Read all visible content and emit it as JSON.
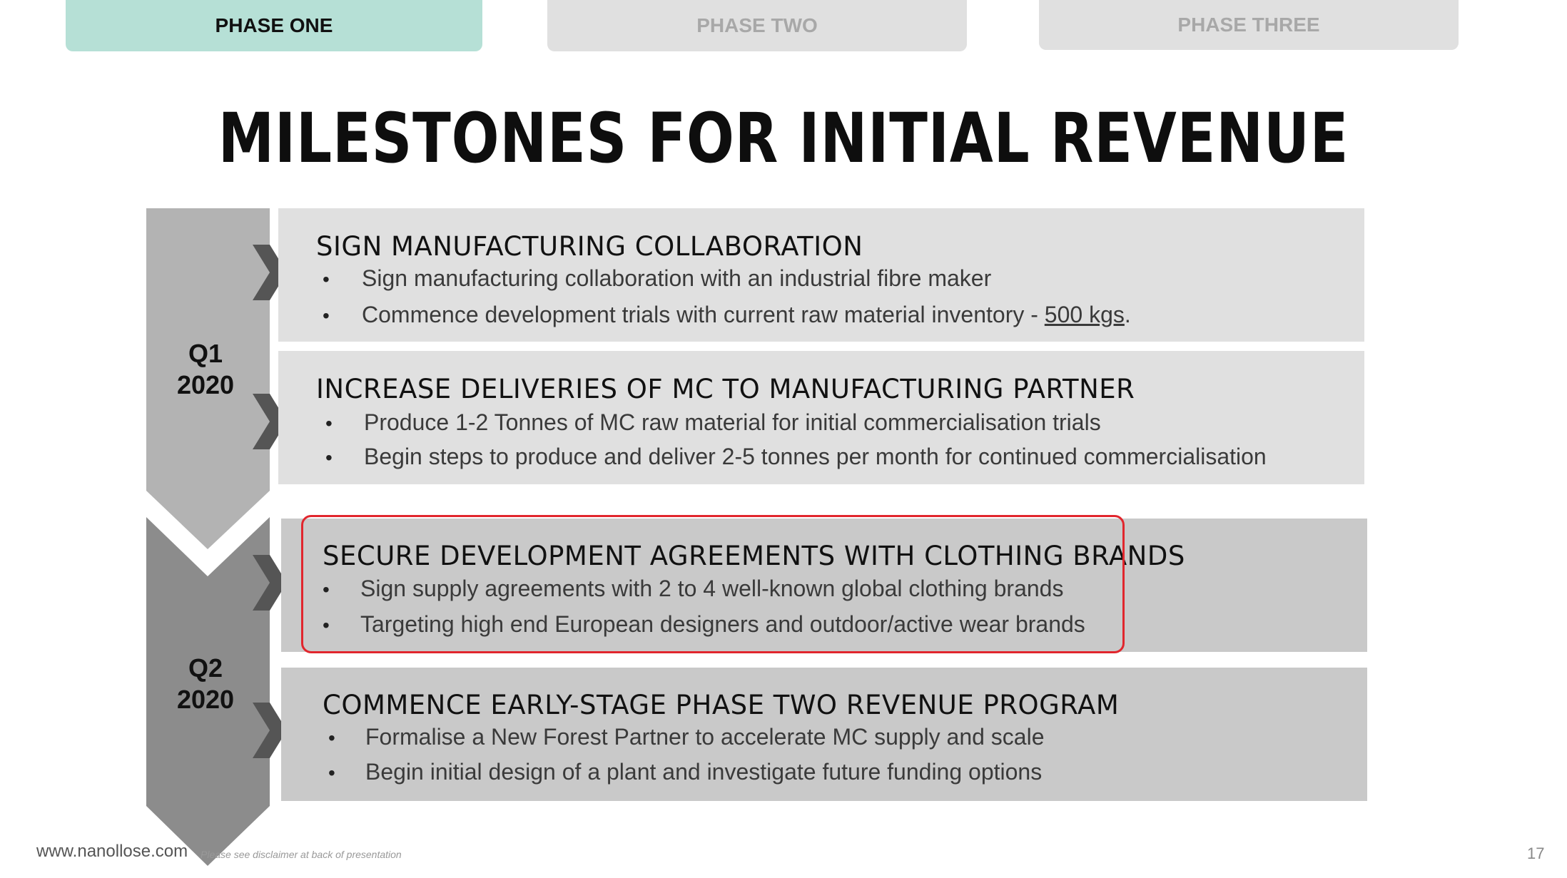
{
  "tabs": [
    "PHASE ONE",
    "PHASE TWO",
    "PHASE THREE"
  ],
  "active_tab": "PHASE ONE",
  "title": "MILESTONES FOR INITIAL REVENUE",
  "quarters": [
    {
      "label": "Q1",
      "year": "2020"
    },
    {
      "label": "Q2",
      "year": "2020"
    }
  ],
  "milestones": [
    {
      "title": "SIGN MANUFACTURING COLLABORATION",
      "bullets": [
        "Sign manufacturing collaboration with an industrial fibre maker",
        "Commence development trials with current raw material inventory - ",
        "500 kgs",
        "."
      ]
    },
    {
      "title": "INCREASE DELIVERIES OF MC TO MANUFACTURING PARTNER",
      "bullets": [
        "Produce 1-2 Tonnes of MC raw material for initial commercialisation trials",
        "Begin steps to produce and deliver 2-5 tonnes per month for continued commercialisation"
      ]
    },
    {
      "title": "SECURE DEVELOPMENT AGREEMENTS WITH CLOTHING BRANDS",
      "bullets": [
        "Sign supply agreements with 2 to 4 well-known global clothing brands",
        "Targeting high end European designers and outdoor/active wear brands"
      ]
    },
    {
      "title": "COMMENCE EARLY-STAGE PHASE TWO REVENUE PROGRAM",
      "bullets": [
        "Formalise a New Forest Partner to accelerate MC supply and scale",
        "Begin initial design of a plant and investigate future funding options"
      ]
    }
  ],
  "bullet_glyph": "•",
  "footer": {
    "url": "www.nanollose.com",
    "disclaimer": "Please see disclaimer at back of presentation",
    "page": "17"
  },
  "colors": {
    "active_tab": "#b6e0d6",
    "inactive_tab": "#e0e0e0",
    "q1_arrow": "#b3b3b3",
    "q2_arrow": "#8c8c8c",
    "chevron": "#555555",
    "highlight_border": "#e1262d"
  }
}
